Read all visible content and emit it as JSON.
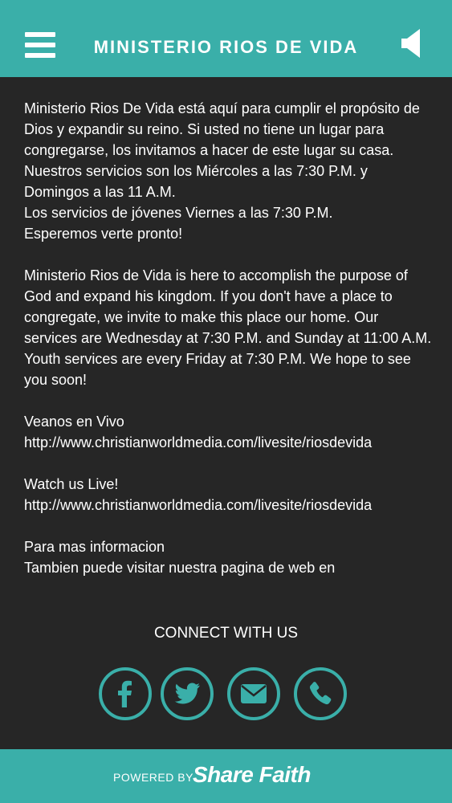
{
  "header": {
    "title": "MINISTERIO RIOS DE VIDA",
    "menu_icon": "hamburger-menu-icon",
    "audio_icon": "speaker-icon",
    "color": "#3aafa9"
  },
  "content": {
    "paragraphs": [
      "Ministerio Rios De Vida está aquí para cumplir el propósito de Dios y expandir su reino. Si usted no tiene un lugar para congregarse, los invitamos a hacer de este lugar su casa. Nuestros servicios son los Miércoles a las 7:30 P.M. y Domingos a las 11 A.M.\nLos servicios de jóvenes Viernes a las 7:30 P.M.\nEsperemos verte pronto!",
      "Ministerio Rios de Vida is here to accomplish the purpose of God and expand his kingdom. If you don't have a place to congregate, we invite to make this place our home. Our services are Wednesday at 7:30 P.M. and Sunday at 11:00 A.M.\nYouth services are every Friday at 7:30 P.M. We hope to see you soon!",
      "Veanos en Vivo\nhttp://www.christianworldmedia.com/livesite/riosdevida",
      "Watch us Live!\nhttp://www.christianworldmedia.com/livesite/riosdevida",
      "Para  mas informacion\nTambien puede visitar nuestra pagina de web en"
    ]
  },
  "connect": {
    "title": "CONNECT WITH US",
    "icons": [
      "facebook-icon",
      "twitter-icon",
      "email-icon",
      "phone-icon"
    ]
  },
  "footer": {
    "powered_by": "POWERED BY",
    "brand": "Share Faith"
  }
}
